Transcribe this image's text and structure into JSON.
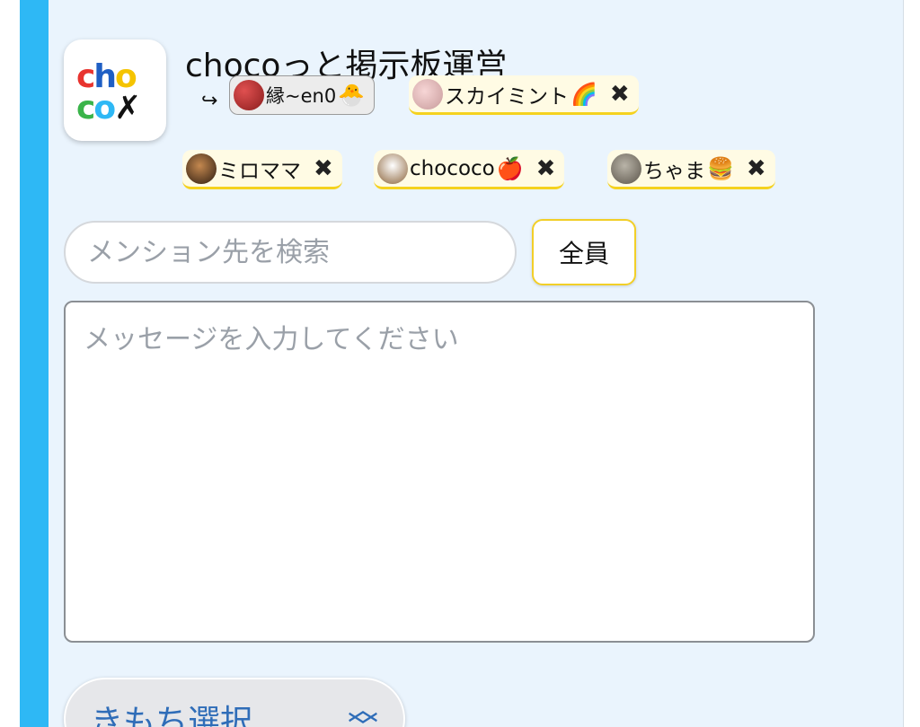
{
  "header": {
    "title": "chocoっと掲示板運営",
    "logo_text_line1": "cho",
    "logo_text_line2": "co"
  },
  "reply": {
    "arrow": "↪",
    "target_name": "縁~en0",
    "target_emoji": "🐣"
  },
  "mentions": [
    {
      "name": "スカイミント",
      "emoji": "🌈"
    },
    {
      "name": "ミロママ",
      "emoji": ""
    },
    {
      "name": "chococo",
      "emoji": "🍎"
    },
    {
      "name": "ちゃま",
      "emoji": "🍔"
    }
  ],
  "remove_icon": "✖",
  "search": {
    "placeholder": "メンション先を検索"
  },
  "all_button": {
    "label": "全員"
  },
  "message": {
    "placeholder": "メッセージを入力してください"
  },
  "mood": {
    "label": "きもち選択",
    "icon": "chevron-up-down-icon"
  },
  "colors": {
    "accent": "#2eb8f5",
    "panel": "#eaf4fd",
    "chip_border": "#f5d21e"
  }
}
